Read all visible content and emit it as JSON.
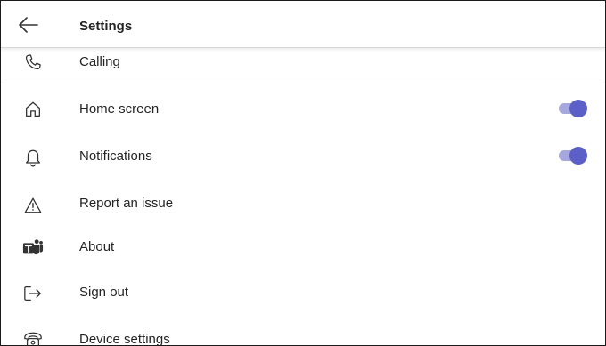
{
  "header": {
    "title": "Settings",
    "back_icon": "arrow-left-icon"
  },
  "settings": {
    "items": [
      {
        "label": "Calling",
        "icon": "phone-icon"
      },
      {
        "label": "Home screen",
        "icon": "home-icon",
        "toggle": true
      },
      {
        "label": "Notifications",
        "icon": "bell-icon",
        "toggle": true
      },
      {
        "label": "Report an issue",
        "icon": "warning-icon"
      },
      {
        "label": "About",
        "icon": "teams-logo-icon"
      },
      {
        "label": "Sign out",
        "icon": "sign-out-icon"
      },
      {
        "label": "Device settings",
        "icon": "device-phone-icon"
      }
    ]
  },
  "colors": {
    "accent": "#5b5fc7",
    "toggle_track": "#a6a7dc",
    "text": "#242424",
    "divider": "#e6e6e6"
  }
}
